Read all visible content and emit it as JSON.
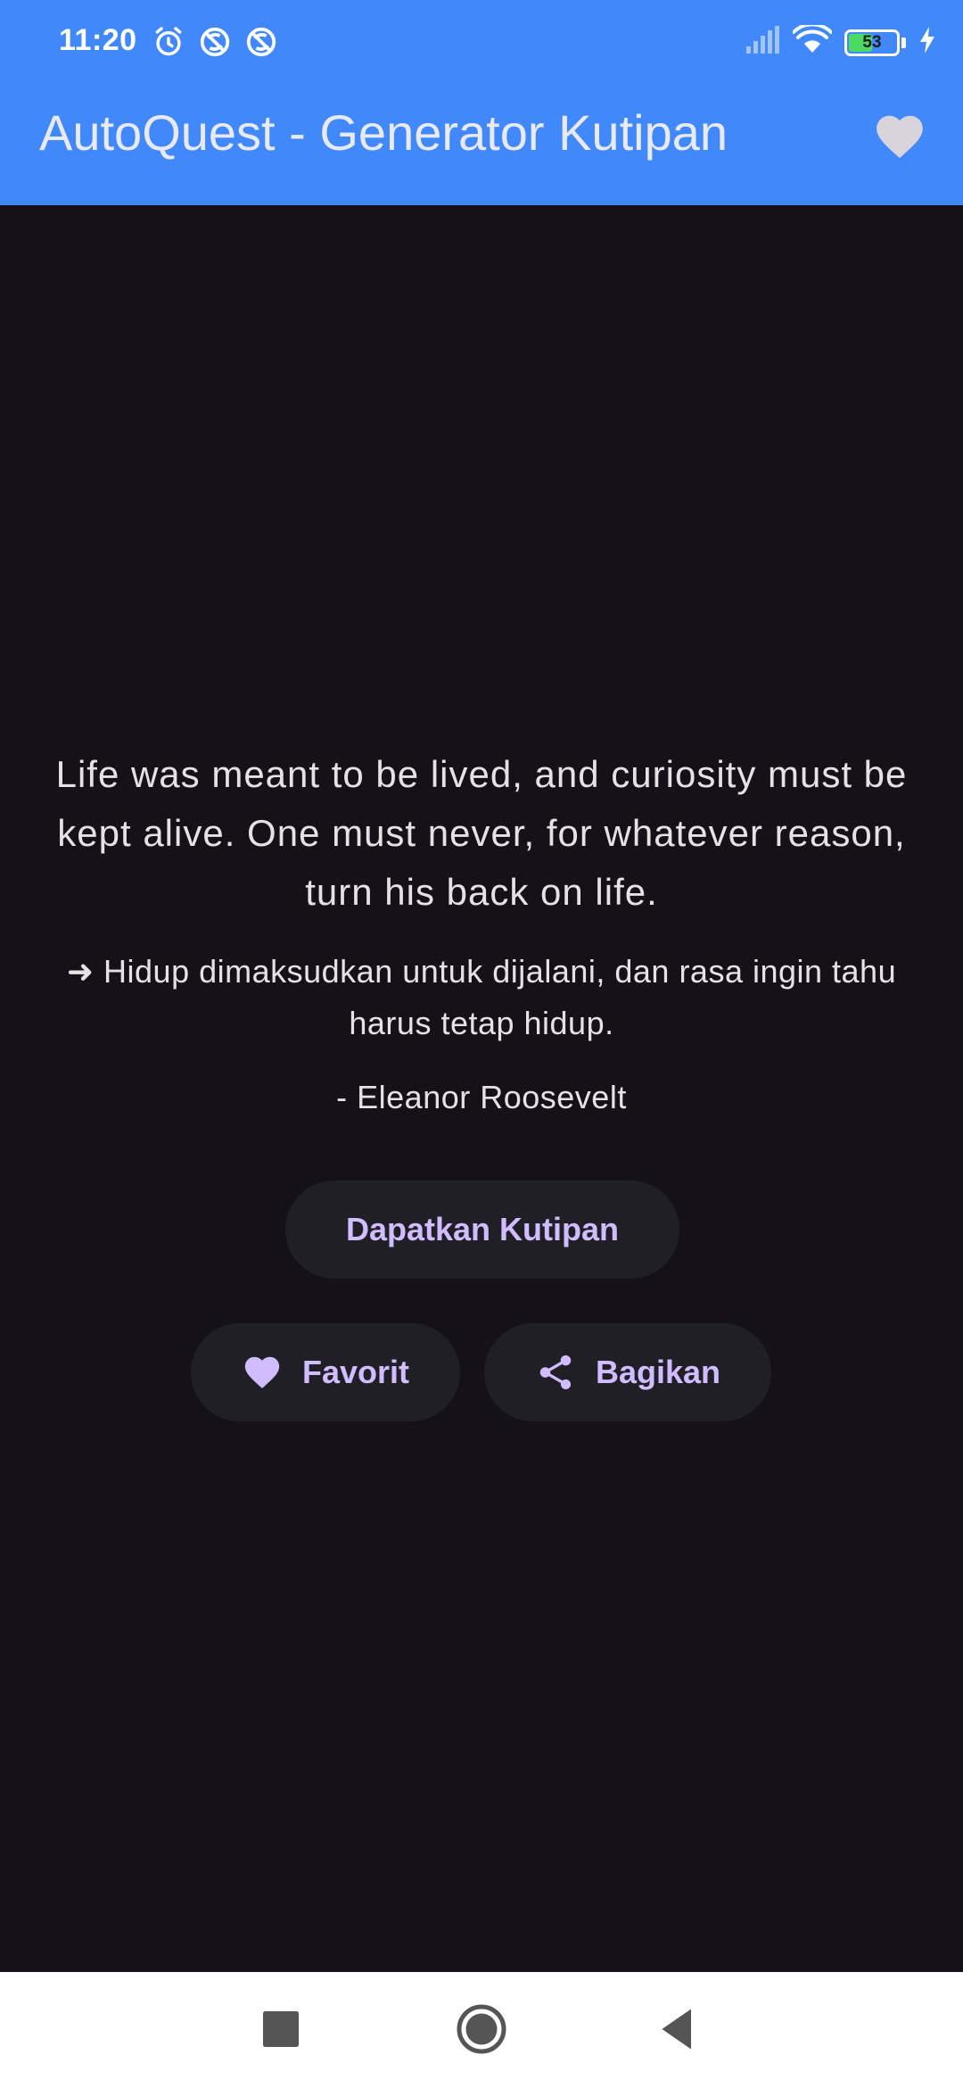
{
  "status_bar": {
    "time": "11:20",
    "battery_level": "53",
    "battery_fraction": 0.53,
    "left_icons": [
      "alarm-icon",
      "do-not-disturb-icon",
      "do-not-disturb-icon"
    ],
    "right_icons": [
      "signal-icon",
      "wifi-icon",
      "battery-icon",
      "charging-icon"
    ]
  },
  "app_bar": {
    "title": "AutoQuest - Generator Kutipan",
    "background_color": "#4189fb",
    "action_icon": "heart-icon"
  },
  "quote": {
    "text": "Life was meant to be lived, and curiosity must be kept alive. One must never, for whatever reason, turn his back on life.",
    "translation": "➜ Hidup dimaksudkan untuk dijalani, dan rasa ingin tahu harus tetap hidup.",
    "author": "- Eleanor Roosevelt"
  },
  "actions": {
    "get_quote_label": "Dapatkan Kutipan",
    "favorite_label": "Favorit",
    "favorite_icon": "heart-icon",
    "share_label": "Bagikan",
    "share_icon": "share-icon",
    "accent_color": "#d0bcff"
  },
  "nav_bar": {
    "items": [
      "recent-apps-icon",
      "home-icon",
      "back-icon"
    ]
  },
  "colors": {
    "background": "#141218",
    "button_surface": "#211f26",
    "text": "#e6e1e5"
  }
}
